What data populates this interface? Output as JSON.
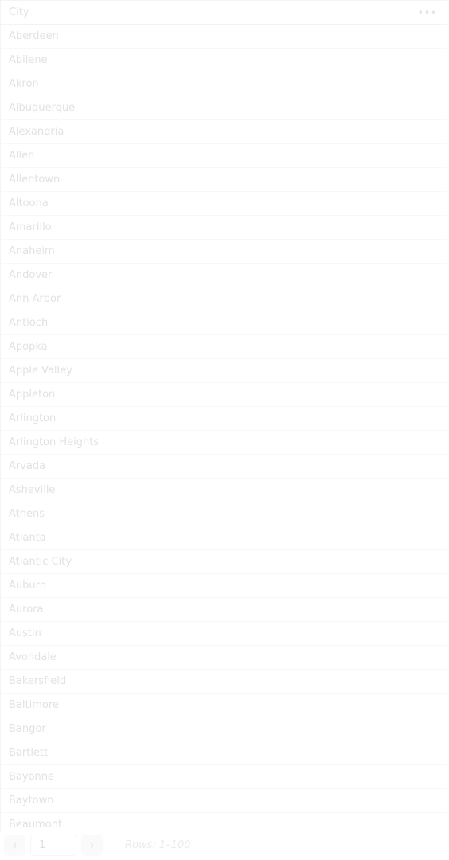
{
  "table": {
    "column_header": "City",
    "menu_icon": "more-horizontal-icon",
    "rows": [
      "Aberdeen",
      "Abilene",
      "Akron",
      "Albuquerque",
      "Alexandria",
      "Allen",
      "Allentown",
      "Altoona",
      "Amarillo",
      "Anaheim",
      "Andover",
      "Ann Arbor",
      "Antioch",
      "Apopka",
      "Apple Valley",
      "Appleton",
      "Arlington",
      "Arlington Heights",
      "Arvada",
      "Asheville",
      "Athens",
      "Atlanta",
      "Atlantic City",
      "Auburn",
      "Aurora",
      "Austin",
      "Avondale",
      "Bakersfield",
      "Baltimore",
      "Bangor",
      "Bartlett",
      "Bayonne",
      "Baytown",
      "Beaumont"
    ]
  },
  "pagination": {
    "prev_icon": "chevron-left-icon",
    "next_icon": "chevron-right-icon",
    "page": "1",
    "rows_label": "Rows: 1–100"
  }
}
